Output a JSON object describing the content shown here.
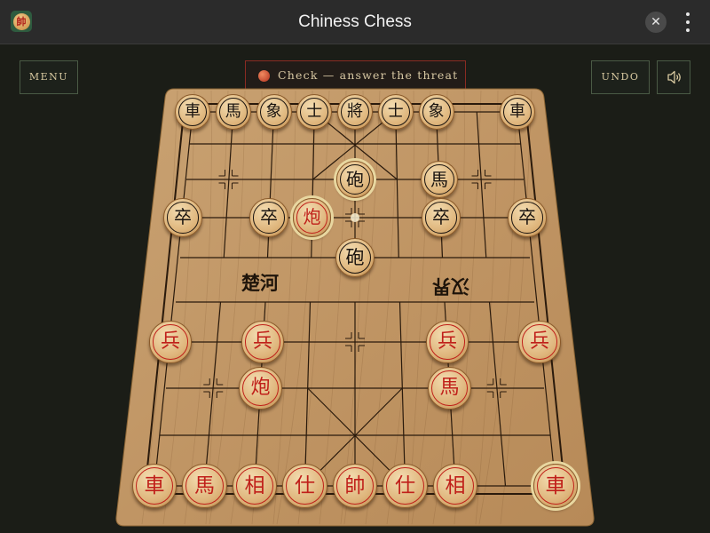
{
  "window": {
    "title": "Chiness Chess",
    "app_icon_glyph": "帥",
    "close_glyph": "✕",
    "icons": [
      "app-icon",
      "close-icon",
      "more-vertical-icon",
      "speaker-icon",
      "alert-dot-icon"
    ]
  },
  "toolbar": {
    "menu_label": "MENU",
    "undo_label": "UNDO",
    "status_text": "Check — answer the threat"
  },
  "board": {
    "river_left": "楚河",
    "river_right": "汉界",
    "colors": {
      "wood": "#c49a66",
      "line": "#2a1a0c",
      "red_piece_text": "#c0201a",
      "black_piece_text": "#1a1410",
      "highlight": "#e8d7a0"
    },
    "black_pieces": [
      {
        "char": "車",
        "file": 0,
        "rank": 0
      },
      {
        "char": "馬",
        "file": 1,
        "rank": 0
      },
      {
        "char": "象",
        "file": 2,
        "rank": 0
      },
      {
        "char": "士",
        "file": 3,
        "rank": 0
      },
      {
        "char": "將",
        "file": 4,
        "rank": 0
      },
      {
        "char": "士",
        "file": 5,
        "rank": 0
      },
      {
        "char": "象",
        "file": 6,
        "rank": 0
      },
      {
        "char": "車",
        "file": 8,
        "rank": 0
      },
      {
        "char": "砲",
        "file": 4,
        "rank": 2,
        "highlight": true
      },
      {
        "char": "馬",
        "file": 6,
        "rank": 2
      },
      {
        "char": "卒",
        "file": 0,
        "rank": 3
      },
      {
        "char": "卒",
        "file": 2,
        "rank": 3
      },
      {
        "char": "卒",
        "file": 6,
        "rank": 3
      },
      {
        "char": "卒",
        "file": 8,
        "rank": 3
      },
      {
        "char": "砲",
        "file": 4,
        "rank": 4
      }
    ],
    "red_pieces": [
      {
        "char": "炮",
        "file": 3,
        "rank": 3,
        "highlight": true
      },
      {
        "char": "兵",
        "file": 0,
        "rank": 6
      },
      {
        "char": "兵",
        "file": 2,
        "rank": 6
      },
      {
        "char": "兵",
        "file": 6,
        "rank": 6
      },
      {
        "char": "兵",
        "file": 8,
        "rank": 6
      },
      {
        "char": "炮",
        "file": 2,
        "rank": 7
      },
      {
        "char": "馬",
        "file": 6,
        "rank": 7
      },
      {
        "char": "車",
        "file": 0,
        "rank": 9
      },
      {
        "char": "馬",
        "file": 1,
        "rank": 9
      },
      {
        "char": "相",
        "file": 2,
        "rank": 9
      },
      {
        "char": "仕",
        "file": 3,
        "rank": 9
      },
      {
        "char": "帥",
        "file": 4,
        "rank": 9
      },
      {
        "char": "仕",
        "file": 5,
        "rank": 9
      },
      {
        "char": "相",
        "file": 6,
        "rank": 9
      },
      {
        "char": "車",
        "file": 8,
        "rank": 9,
        "highlight": true
      }
    ],
    "last_move_marker": {
      "file": 4,
      "rank": 3
    }
  }
}
